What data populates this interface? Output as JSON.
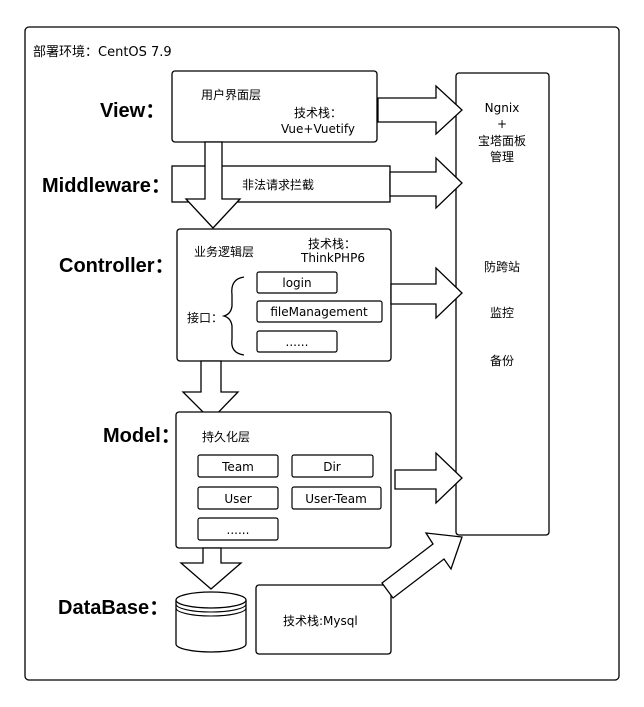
{
  "header": {
    "env": "部署环境：CentOS 7.9"
  },
  "layers": {
    "view": "View：",
    "middleware": "Middleware：",
    "controller": "Controller：",
    "model": "Model：",
    "database": "DataBase："
  },
  "view_box": {
    "title": "用户界面层",
    "tech_label": "技术栈：",
    "tech_value": "Vue+Vuetify"
  },
  "middleware_box": {
    "text": "非法请求拦截"
  },
  "controller_box": {
    "title": "业务逻辑层",
    "tech_label": "技术栈：",
    "tech_value": "ThinkPHP6",
    "interface_label": "接口：",
    "items": [
      "login",
      "fileManagement",
      "......"
    ]
  },
  "model_box": {
    "title": "持久化层",
    "items": [
      "Team",
      "Dir",
      "User",
      "User-Team",
      "......"
    ]
  },
  "database_box": {
    "text": "技术栈:Mysql"
  },
  "right_panel": {
    "nginx_line1": "Ngnix",
    "nginx_line2": "+",
    "nginx_line3": "宝塔面板",
    "nginx_line4": "管理",
    "item1": "防跨站",
    "item2": "监控",
    "item3": "备份"
  }
}
